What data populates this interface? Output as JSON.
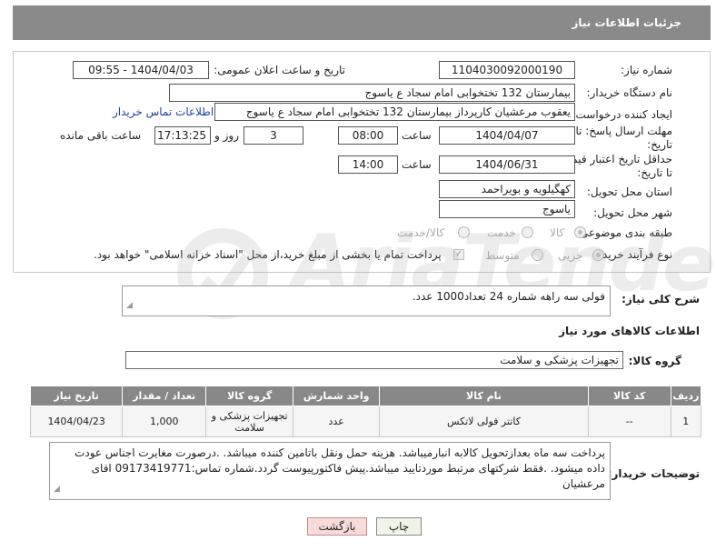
{
  "header": {
    "title": "جزئیات اطلاعات نیاز"
  },
  "fields": {
    "need_number_label": "شماره نیاز:",
    "need_number": "1104030092000190",
    "announce_label": "تاریخ و ساعت اعلان عمومی:",
    "announce_value": "1404/04/03 - 09:55",
    "buyer_org_label": "نام دستگاه خریدار:",
    "buyer_org": "بیمارستان 132 تختخوابی امام سجاد  ع  یاسوج",
    "creator_label": "ایجاد کننده درخواست:",
    "creator": "یعقوب مرعشیان کارپرداز بیمارستان 132 تختخوابی امام سجاد  ع  یاسوج",
    "buyer_contact_link": "اطلاعات تماس خریدار",
    "deadline_label_1": "مهلت ارسال پاسخ: تا",
    "deadline_label_2": "تاریخ:",
    "deadline_date": "1404/04/07",
    "time_label": "ساعت",
    "deadline_time": "08:00",
    "days_value": "3",
    "days_label": "روز و",
    "remaining_time": "17:13:25",
    "remaining_label": "ساعت باقی مانده",
    "price_label_1": "حداقل تاریخ اعتبار قیمت:",
    "price_label_2": "تا تاریخ:",
    "price_date": "1404/06/31",
    "price_time": "14:00",
    "province_label": "استان محل تحویل:",
    "province": "کهگیلویه و بویراحمد",
    "city_label": "شهر محل تحویل:",
    "city": "یاسوج",
    "category_label": "طبقه بندی موضوعی:",
    "category_options": [
      "کالا",
      "خدمت",
      "کالا/خدمت"
    ],
    "process_label": "نوع فرآیند خرید :",
    "process_options": [
      "جزیی",
      "متوسط"
    ],
    "payment_note": "پرداخت تمام یا بخشی از مبلغ خرید،از محل \"اسناد خزانه اسلامی\" خواهد بود."
  },
  "description": {
    "label": "شرح کلی نیاز:",
    "text": "فولی سه راهه شماره 24 تعداد1000 عدد."
  },
  "goods_section": {
    "title": "اطلاعات کالاهای مورد نیاز",
    "group_label": "گروه کالا:",
    "group_value": "تجهیزات پزشکی و سلامت"
  },
  "table": {
    "headers": [
      "ردیف",
      "کد کالا",
      "نام کالا",
      "واحد شمارش",
      "گروه کالا",
      "تعداد / مقدار",
      "تاریخ نیاز"
    ],
    "rows": [
      [
        "1",
        "--",
        "کاتتر فولی لاتکس",
        "عدد",
        "تجهیزات پزشکی و سلامت",
        "1,000",
        "1404/04/23"
      ]
    ]
  },
  "buyer_notes": {
    "label": "توضیحات خریدار:",
    "text": "پرداخت سه ماه بعدازتحویل کالابه انبارمیباشد. هزینه حمل ونقل باتامین کننده میباشد. .درصورت مغایرت اجناس عودت داده میشود. .فقط شرکتهای مرتبط موردتایید میباشد.پیش فاکتورپیوست گردد.شماره تماس:09173419771 اقای مرعشیان"
  },
  "buttons": {
    "print": "چاپ",
    "back": "بازگشت"
  },
  "watermark": {
    "text": "AriaTender.neT"
  }
}
